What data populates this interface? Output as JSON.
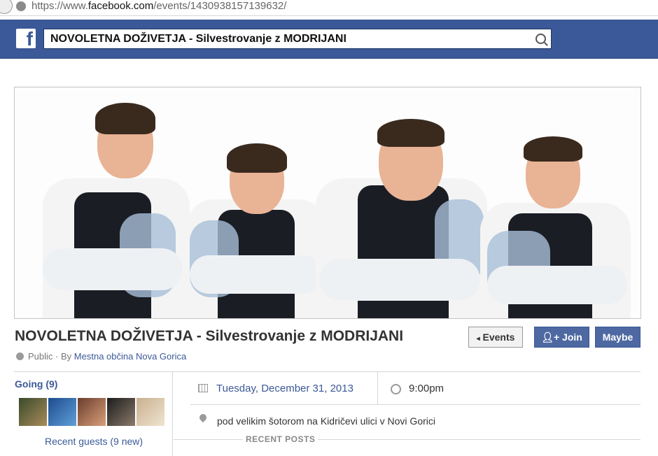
{
  "browser": {
    "url_prefix": "https://www.",
    "url_domain": "facebook.com",
    "url_path": "/events/1430938157139632/"
  },
  "header": {
    "logo": "f",
    "search_query": "NOVOLETNA DOŽIVETJA  - Silvestrovanje z MODRIJANI"
  },
  "event": {
    "title": "NOVOLETNA DOŽIVETJA - Silvestrovanje z MODRIJANI",
    "privacy": "Public",
    "by_label": "· By",
    "host": "Mestna občina Nova Gorica",
    "buttons": {
      "events": "Events",
      "join": "Join",
      "maybe": "Maybe"
    },
    "going_title": "Going (9)",
    "recent_guests": "Recent guests (9 new)",
    "date": "Tuesday, December 31, 2013",
    "time": "9:00pm",
    "location": "pod velikim šotorom na Kidričevi ulici v Novi Gorici",
    "recent_posts": "RECENT POSTS"
  },
  "colors": {
    "brand": "#3b5998",
    "link": "#3b5998",
    "text": "#333333"
  }
}
